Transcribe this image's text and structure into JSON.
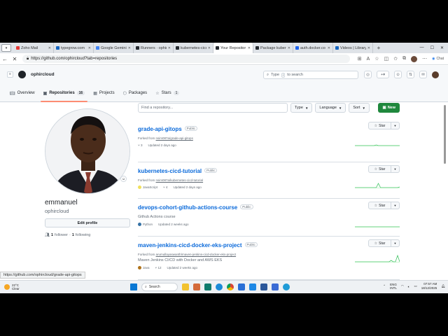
{
  "browser": {
    "tabs": [
      {
        "label": "Zoho Mail",
        "color": "#e53935"
      },
      {
        "label": "typegrow.com",
        "color": "#1565c0"
      },
      {
        "label": "Google Gemini",
        "color": "#4285f4"
      },
      {
        "label": "Runners · ophir",
        "color": "#24292f"
      },
      {
        "label": "kubernetes-cicd",
        "color": "#24292f"
      },
      {
        "label": "Your Repositor",
        "color": "#24292f",
        "active": true
      },
      {
        "label": "Package kuber",
        "color": "#24292f"
      },
      {
        "label": "auth.docker.co",
        "color": "#1d63ed"
      },
      {
        "label": "Videos | Library",
        "color": "#1565c0"
      }
    ],
    "url": "https://github.com/ophircloud?tab=repositories",
    "chat_label": "Chat"
  },
  "github": {
    "owner": "ophircloud",
    "search_placeholder_pre": "Type",
    "search_key": "/",
    "search_placeholder_post": "to search",
    "tabs": [
      {
        "label": "Overview",
        "icon": "book-icon"
      },
      {
        "label": "Repositories",
        "count": "16",
        "icon": "repo-icon",
        "selected": true
      },
      {
        "label": "Projects",
        "icon": "table-icon"
      },
      {
        "label": "Packages",
        "icon": "package-icon"
      },
      {
        "label": "Stars",
        "count": "1",
        "icon": "star-icon"
      }
    ]
  },
  "profile": {
    "name": "emmanuel",
    "login": "ophircloud",
    "edit_label": "Edit profile",
    "followers": "1",
    "followers_label": "follower",
    "following": "1",
    "following_label": "following"
  },
  "repo_filter": {
    "placeholder": "Find a repository...",
    "type_label": "Type",
    "language_label": "Language",
    "sort_label": "Sort",
    "new_label": "New"
  },
  "repos": [
    {
      "name": "grade-api-gitops",
      "visibility": "Public",
      "fork_prefix": "Forked from",
      "fork_of": "nsim087a/grade-api-gitops",
      "description": "",
      "language": "",
      "lang_color": "",
      "forks": "3",
      "updated": "Updated 2 days ago",
      "star_label": "Star"
    },
    {
      "name": "kubernetes-cicd-tutorial",
      "visibility": "Public",
      "fork_prefix": "Forked from",
      "fork_of": "nsim087a/kubernetes-cicd-tutorial",
      "description": "",
      "language": "JavaScript",
      "lang_color": "#f1e05a",
      "forks": "4",
      "updated": "Updated 2 days ago",
      "star_label": "Star"
    },
    {
      "name": "devops-cohort-github-actions-course",
      "visibility": "Public",
      "fork_prefix": "",
      "fork_of": "",
      "description": "Github Actions course",
      "language": "Python",
      "lang_color": "#3572a5",
      "forks": "",
      "updated": "Updated 2 weeks ago",
      "star_label": "Star"
    },
    {
      "name": "maven-jenkins-cicd-docker-eks-project",
      "visibility": "Public",
      "fork_prefix": "Forked from",
      "fork_of": "arumullayaswanth/maven-jenkins-cicd-docker-eks-project",
      "description": "Maven Jenkins CI/CD with Docker and AWS EKS",
      "language": "Java",
      "lang_color": "#b07219",
      "forks": "12",
      "updated": "Updated 2 weeks ago",
      "star_label": "Star"
    }
  ],
  "status_url": "https://github.com/ophircloud/grade-api-gitops",
  "taskbar": {
    "temp": "22°C",
    "weather": "Clear",
    "search_label": "Search",
    "lang_top": "ENG",
    "lang_bottom": "INTL",
    "time": "07:57 AM",
    "date": "18/12/2025"
  }
}
